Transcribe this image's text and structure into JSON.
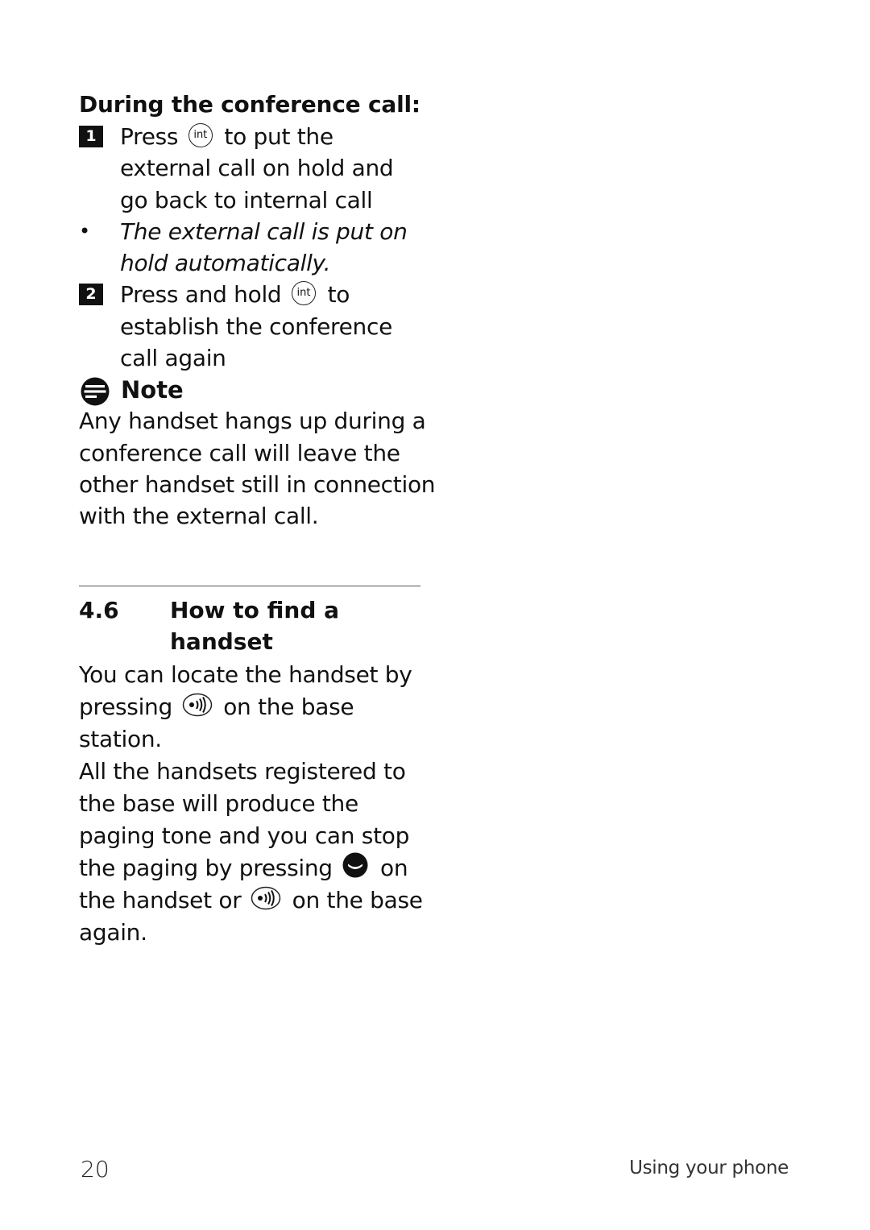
{
  "conference": {
    "heading": "During the conference call:",
    "step1": {
      "number": "1",
      "line1_before": "Press",
      "icon_label": "int",
      "line1_after": "to put the",
      "line2": "external call on hold and",
      "line3": "go back to internal call"
    },
    "result": {
      "bullet": "•",
      "line1": "The external call is put on",
      "line2": "hold automatically."
    },
    "step2": {
      "number": "2",
      "line1_before": "Press and hold",
      "icon_label": "int",
      "line1_after": "to",
      "line2": "establish the conference",
      "line3": "call again"
    }
  },
  "note": {
    "title": "Note",
    "lines": [
      "Any handset hangs up during a",
      "conference call will leave the",
      "other handset still in connection",
      "with the external call."
    ]
  },
  "section": {
    "number": "4.6",
    "title": "How to find a\nhandset",
    "para1": {
      "line1": "You can locate the handset by",
      "line2_before": "pressing",
      "line2_after": "on the base",
      "line3": "station."
    },
    "para2": {
      "line1": "All the handsets registered to",
      "line2": "the base will produce the",
      "line3": "paging tone and you can stop",
      "line4_before": "the paging by pressing",
      "line4_after": "on",
      "line5_before": "the handset or",
      "line5_after": "on the base",
      "line6": "again."
    },
    "icons": {
      "page_button": "page-icon",
      "end_call_button": "end-call-icon"
    }
  },
  "footer": {
    "page_number": "20",
    "chapter_title": "Using your phone"
  },
  "colors": {
    "text": "#111111",
    "background": "#ffffff",
    "rule": "#555555"
  }
}
